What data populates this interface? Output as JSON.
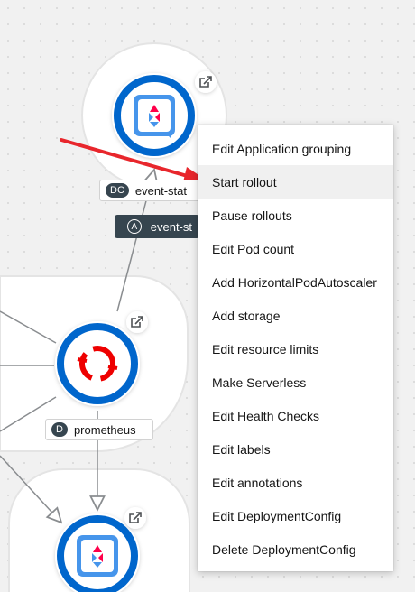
{
  "topology": {
    "nodes": [
      {
        "kind_badge": "DC",
        "name": "event-stat",
        "icon": "quarkus-icon"
      },
      {
        "kind_badge": "D",
        "name": "prometheus",
        "icon": "openshift-icon"
      },
      {
        "icon": "quarkus-icon"
      }
    ],
    "application_group": {
      "badge": "A",
      "name": "event-st"
    },
    "link_icon": "external-link-icon"
  },
  "annotation": {
    "arrow_color": "#e8262c"
  },
  "context_menu": {
    "active_index": 1,
    "items": [
      {
        "label": "Edit Application grouping"
      },
      {
        "label": "Start rollout"
      },
      {
        "label": "Pause rollouts"
      },
      {
        "label": "Edit Pod count"
      },
      {
        "label": "Add HorizontalPodAutoscaler"
      },
      {
        "label": "Add storage"
      },
      {
        "label": "Edit resource limits"
      },
      {
        "label": "Make Serverless"
      },
      {
        "label": "Edit Health Checks"
      },
      {
        "label": "Edit labels"
      },
      {
        "label": "Edit annotations"
      },
      {
        "label": "Edit DeploymentConfig"
      },
      {
        "label": "Delete DeploymentConfig"
      }
    ]
  },
  "colors": {
    "node_ring": "#0066cc",
    "openshift_red": "#ee0000",
    "label_dark": "#36454f"
  }
}
